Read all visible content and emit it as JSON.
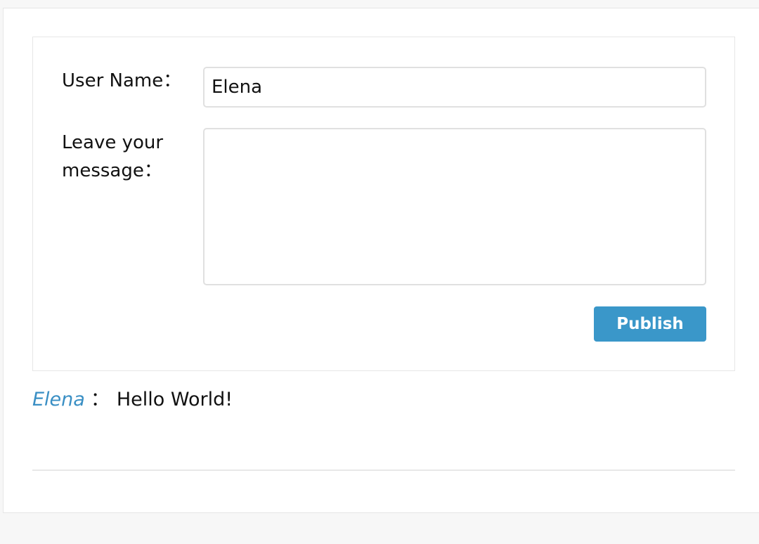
{
  "form": {
    "name_label": "User Name：",
    "name_value": "Elena",
    "message_label": "Leave your message：",
    "message_value": "",
    "publish_label": "Publish"
  },
  "comments": [
    {
      "author": "Elena",
      "separator": "：",
      "text": "Hello World!"
    }
  ],
  "colors": {
    "accent": "#3a97c9",
    "author_link": "#3a8fc4"
  }
}
